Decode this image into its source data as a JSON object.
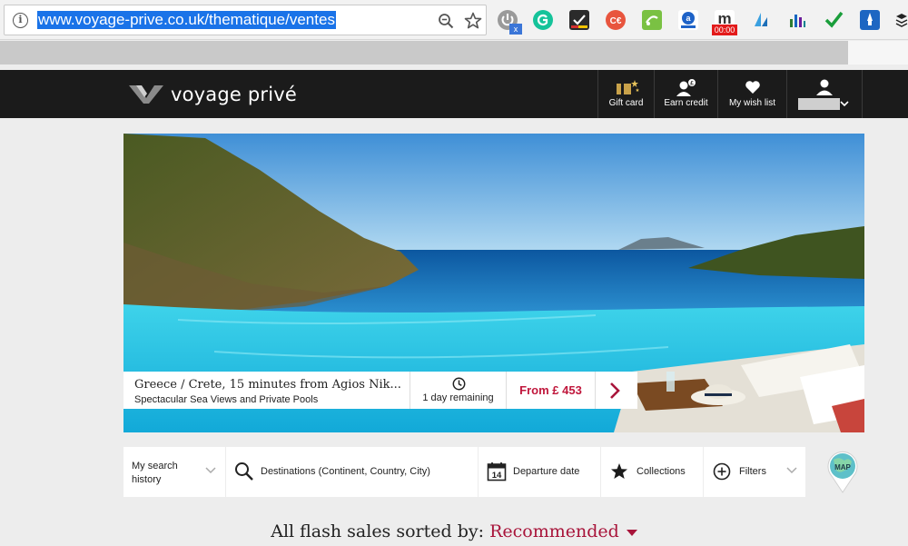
{
  "browser": {
    "url": "www.voyage-prive.co.uk/thematique/ventes",
    "extensions": [
      "power-icon",
      "grammarly-icon",
      "checklist-icon",
      "coupon-icon",
      "sparkle-icon",
      "amazon-icon",
      "m-icon",
      "sail-icon",
      "bars-icon",
      "checkmark-icon",
      "rocket-icon"
    ],
    "timer_badge": "00:00",
    "ext_badge": "x"
  },
  "header": {
    "logo": "voyage privé",
    "nav": [
      {
        "label": "Gift card",
        "icon": "gift-card-icon"
      },
      {
        "label": "Earn credit",
        "icon": "earn-credit-icon"
      },
      {
        "label": "My wish list",
        "icon": "heart-icon"
      }
    ],
    "account_icon": "user-icon"
  },
  "hero": {
    "title": "Greece / Crete, 15 minutes from Agios Nik...",
    "subtitle": "Spectacular Sea Views and Private Pools",
    "time_remaining": "1 day remaining",
    "price": "From £ 453"
  },
  "filters": {
    "history": "My search history",
    "destinations": "Destinations (Continent, Country, City)",
    "departure": "Departure date",
    "collections": "Collections",
    "filters": "Filters",
    "calendar_day": "14",
    "map": "MAP"
  },
  "sort": {
    "prefix": "All flash sales sorted by:",
    "value": "Recommended"
  },
  "colors": {
    "accent": "#a8143a",
    "header_bg": "#1b1b1b",
    "url_highlight": "#1a73e8"
  }
}
